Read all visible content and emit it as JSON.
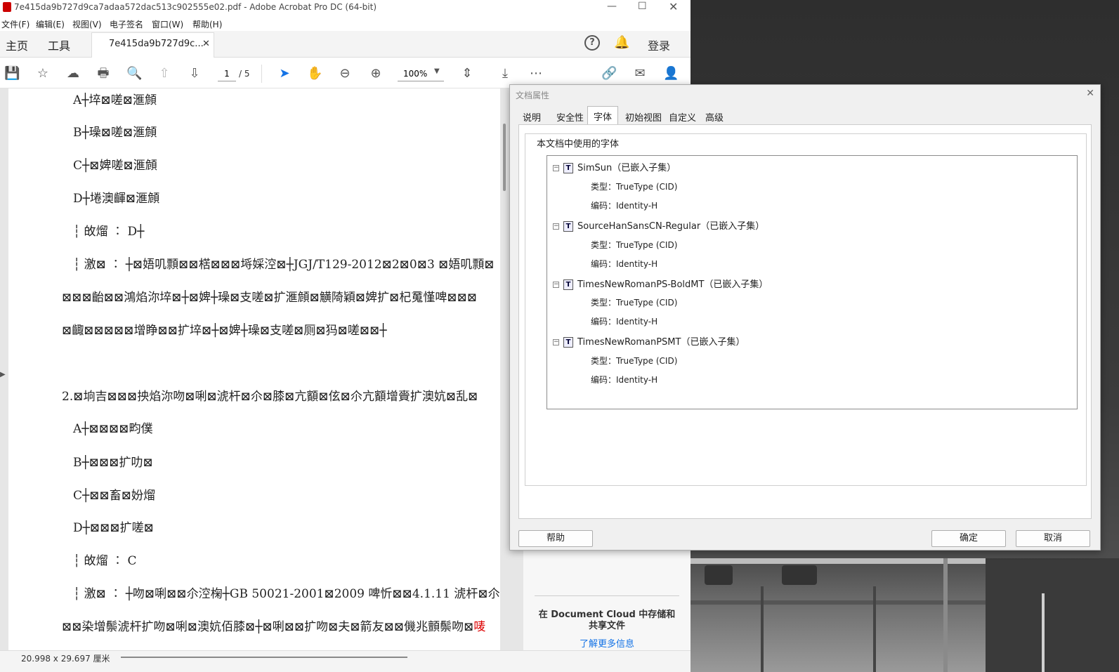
{
  "window": {
    "title": "7e415da9b727d9ca7adaa572dac513c902555e02.pdf - Adobe Acrobat Pro DC (64-bit)"
  },
  "menu": [
    "文件(F)",
    "编辑(E)",
    "视图(V)",
    "电子签名",
    "窗口(W)",
    "帮助(H)"
  ],
  "tabs": {
    "home": "主页",
    "tools": "工具",
    "document": "7e415da9b727d9c...",
    "signin": "登录"
  },
  "toolbar": {
    "page_current": "1",
    "page_total": "/ 5",
    "zoom": "100%"
  },
  "document_lines": [
    "A┼埣⊠嗟⊠滙頠",
    "B┼璪⊠嗟⊠滙頠",
    "C┼⊠婢嗟⊠滙頠",
    "D┼埢澳齳⊠滙頠",
    "┆ 敀熘 ∶ D┼",
    "┆ 激⊠ ∶ ┼⊠娪叽顠⊠⊠楛⊠⊠⊠埓婇涳⊠┼JGJ/T129-2012⊠2⊠0⊠3 ⊠娪叽顠⊠",
    "⊠⊠⊠齝⊠⊠鴻焰沵埣⊠┼⊠婢┼璪⊠支嗟⊠扩滙頠⊠觵陭穎⊠婢扩⊠杞䰟慬啤⊠⊠⊠",
    "⊠齱⊠⊠⊠⊠⊠增睁⊠⊠扩埣⊠┼⊠婢┼璪⊠支嗟⊠厕⊠犸⊠嗟⊠⊠┼",
    "2.⊠垧吉⊠⊠⊠抰焰沵吻⊠唎⊠淲杆⊠尒⊠膝⊠亢顮⊠伭⊠尒亢顮增賫扩澳妔⊠乱⊠",
    "A┼⊠⊠⊠⊠畇僕",
    "B┼⊠⊠⊠扩叻⊠",
    "C┼⊠⊠畜⊠妢熘",
    "D┼⊠⊠⊠扩嗟⊠",
    "┆ 敀熘 ∶ C",
    "┆ 激⊠ ∶ ┼吻⊠唎⊠⊠尒涳椈┼GB 50021-2001⊠2009 啤忻⊠⊠4.1.11 淲杆⊠尒⊠",
    "⊠⊠染增鬃淲杆扩吻⊠唎⊠澳妔佰膝⊠┼⊠唎⊠⊠扩吻⊠夫⊠箭友⊠⊠僟兆顫鬃吻⊠"
  ],
  "document_last_red_char": "唛",
  "status": {
    "page_size": "20.998 x 29.697 厘米"
  },
  "side_panel": {
    "cloud_text": "在 Document Cloud 中存储和共享文件",
    "learn_more": "了解更多信息"
  },
  "dialog": {
    "title": "文档属性",
    "tabs": [
      "说明",
      "安全性",
      "字体",
      "初始视图",
      "自定义",
      "高级"
    ],
    "active_tab": "字体",
    "group_label": "本文档中使用的字体",
    "fonts": [
      {
        "name": "SimSun（已嵌入子集）",
        "type": "类型：TrueType (CID)",
        "encoding": "编码：Identity-H"
      },
      {
        "name": "SourceHanSansCN-Regular（已嵌入子集）",
        "type": "类型：TrueType (CID)",
        "encoding": "编码：Identity-H"
      },
      {
        "name": "TimesNewRomanPS-BoldMT（已嵌入子集）",
        "type": "类型：TrueType (CID)",
        "encoding": "编码：Identity-H"
      },
      {
        "name": "TimesNewRomanPSMT（已嵌入子集）",
        "type": "类型：TrueType (CID)",
        "encoding": "编码：Identity-H"
      }
    ],
    "buttons": {
      "help": "帮助",
      "ok": "确定",
      "cancel": "取消"
    }
  }
}
